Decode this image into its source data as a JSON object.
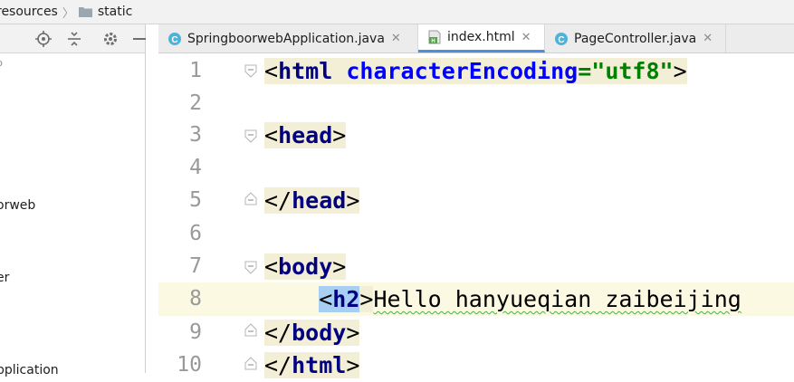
{
  "breadcrumb": {
    "items": [
      "resources",
      "static"
    ]
  },
  "project_panel": {
    "tree_items": [
      "p",
      "orweb",
      "er",
      "pplication"
    ]
  },
  "tabs": [
    {
      "label": "SpringboorwebApplication.java",
      "icon": "java-class-icon",
      "active": false
    },
    {
      "label": "index.html",
      "icon": "html-file-icon",
      "active": true
    },
    {
      "label": "PageController.java",
      "icon": "java-class-icon",
      "active": false
    }
  ],
  "editor": {
    "line_numbers": [
      "1",
      "2",
      "3",
      "4",
      "5",
      "6",
      "7",
      "8",
      "9",
      "10"
    ],
    "current_line": "8",
    "lines": {
      "l1": {
        "open": "<",
        "tag": "html",
        "attr": "characterEncoding",
        "eq": "=",
        "val": "\"utf8\"",
        "close": ">"
      },
      "l3": {
        "open": "<",
        "tag": "head",
        "close": ">"
      },
      "l5": {
        "open": "</",
        "tag": "head",
        "close": ">"
      },
      "l7": {
        "open": "<",
        "tag": "body",
        "close": ">"
      },
      "l8": {
        "indent": "    ",
        "open": "<",
        "tag": "h2",
        "close": ">",
        "text": "Hello hanyueqian zaibeijing"
      },
      "l9": {
        "open": "</",
        "tag": "body",
        "close": ">"
      },
      "l10": {
        "open": "</",
        "tag": "html",
        "close": ">"
      }
    }
  },
  "colors": {
    "tag": "#000080",
    "attribute": "#0000ff",
    "string": "#008000",
    "active_tab_underline": "#4a8fe0",
    "current_line_bg": "#fcf9e2"
  }
}
